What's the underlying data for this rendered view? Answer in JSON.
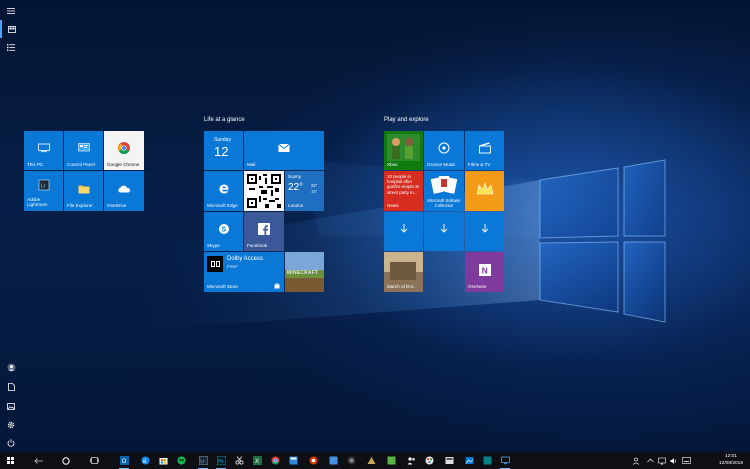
{
  "groups": {
    "left": {
      "tiles": [
        {
          "label": "This PC"
        },
        {
          "label": "Control Panel"
        },
        {
          "label": "Google Chrome"
        },
        {
          "label": "Adobe Lightroom"
        },
        {
          "label": "File Explorer"
        },
        {
          "label": "OneDrive"
        }
      ]
    },
    "life": {
      "title": "Life at a glance",
      "calendar": {
        "day_name": "Sunday",
        "day_number": "12"
      },
      "mail": {
        "label": "Mail"
      },
      "edge": {
        "label": "Microsoft Edge"
      },
      "weather": {
        "condition": "Sunny",
        "temp": "22°",
        "high": "22°",
        "low": "15°",
        "city": "London"
      },
      "skype": {
        "label": "Skype"
      },
      "facebook": {
        "label": "Facebook"
      },
      "dolby": {
        "title": "Dolby Access",
        "price": "Free*"
      },
      "store": {
        "label": "Microsoft Store"
      },
      "minecraft": {
        "label": "MINECRAFT"
      }
    },
    "play": {
      "title": "Play and explore",
      "xbox": {
        "label": "Xbox"
      },
      "groove": {
        "label": "Groove Music"
      },
      "films": {
        "label": "Films & TV"
      },
      "news": {
        "headline": "10 people in hospital after gunfire erupts at street party in...",
        "label": "News"
      },
      "solitaire": {
        "label": "Microsoft Solitaire Collection"
      },
      "march": {
        "label": "March of Em..."
      },
      "onenote": {
        "label": "OneNote"
      }
    }
  },
  "taskbar": {
    "time": "12:01",
    "date": "12/08/2018"
  },
  "colors": {
    "tile_blue": "#0a78d7",
    "news_red": "#d62d20",
    "onenote_purple": "#7e3a9c",
    "xbox_green": "#107c10",
    "king_orange": "#f39a16",
    "skype_blue": "#0078d7",
    "facebook_blue": "#3b5998"
  }
}
